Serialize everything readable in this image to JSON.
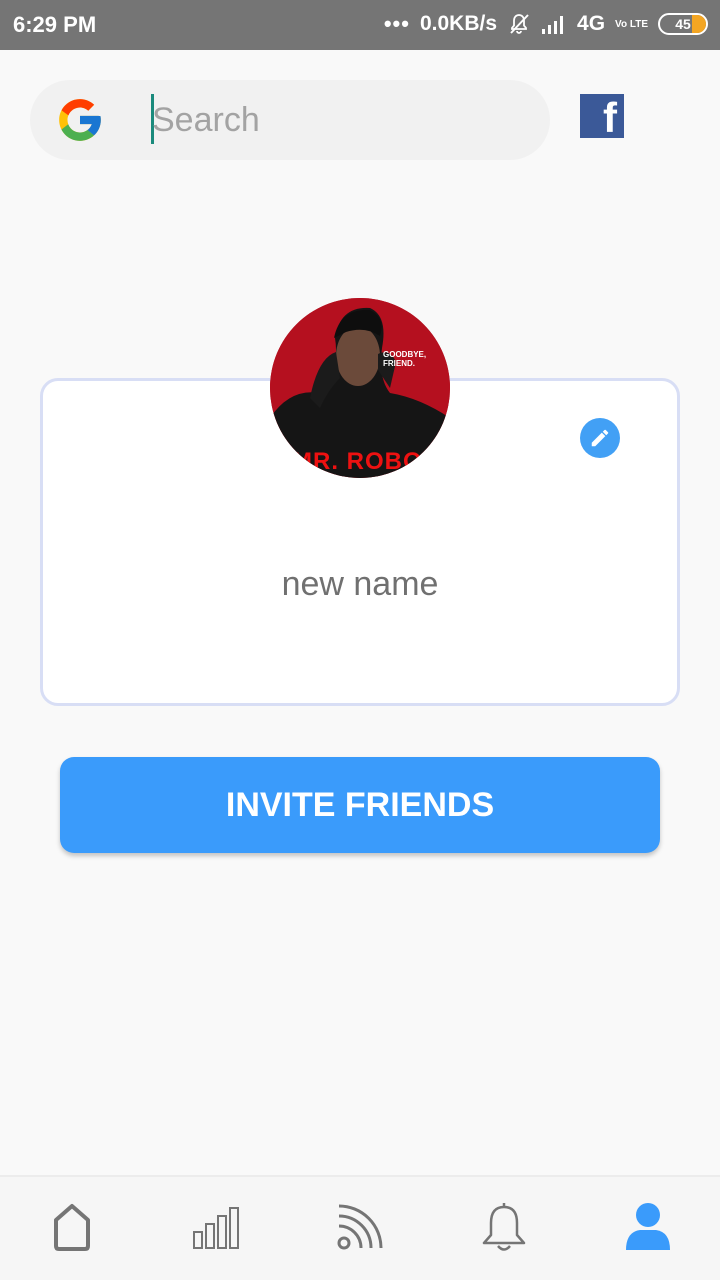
{
  "status_bar": {
    "time": "6:29 PM",
    "dots": "•••",
    "speed": "0.0KB/s",
    "network": "4G",
    "volte": "Vo LTE",
    "battery": "45"
  },
  "search": {
    "placeholder": "Search",
    "value": ""
  },
  "profile": {
    "name": "new name",
    "avatar_tagline": "GOODBYE, FRIEND.",
    "avatar_title": "MR. ROBOT"
  },
  "invite_button": {
    "label": "INVITE FRIENDS"
  },
  "nav": {
    "items": [
      {
        "icon": "home-icon",
        "active": false
      },
      {
        "icon": "stats-icon",
        "active": false
      },
      {
        "icon": "feed-icon",
        "active": false
      },
      {
        "icon": "bell-icon",
        "active": false
      },
      {
        "icon": "profile-icon",
        "active": true
      }
    ]
  },
  "colors": {
    "accent": "#3a9bfb",
    "statusbar": "#757575",
    "facebook": "#3b5998",
    "nav_active": "#3a9bfb",
    "nav_inactive": "#757575"
  }
}
